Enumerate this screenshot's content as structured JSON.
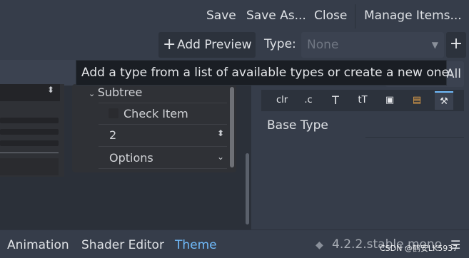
{
  "menu": {
    "save": "Save",
    "save_as": "Save As...",
    "close": "Close",
    "manage_items": "Manage Items..."
  },
  "toolbar": {
    "add_preview_icon": "+",
    "add_preview": "Add Preview",
    "type_label": "Type:",
    "type_value": "None",
    "add_type_icon": "+"
  },
  "tooltip": {
    "text": "Add a type from a list of available types or create a new one."
  },
  "preview": {
    "subtree_label": "Subtree",
    "check_item": "Check Item",
    "spin_value": "2",
    "options_value": "Options"
  },
  "inspector": {
    "all_label": "All",
    "tabs": [
      {
        "icon": "color-icon",
        "glyph": "clr"
      },
      {
        "icon": "constant-icon",
        "glyph": ".c"
      },
      {
        "icon": "font-icon",
        "glyph": "T"
      },
      {
        "icon": "font-size-icon",
        "glyph": "tT"
      },
      {
        "icon": "image-icon",
        "glyph": "▣"
      },
      {
        "icon": "stylebox-icon",
        "glyph": "▤"
      },
      {
        "icon": "tools-icon",
        "glyph": "⚒"
      }
    ],
    "base_type_label": "Base Type"
  },
  "bottom": {
    "tabs": [
      "Animation",
      "Shader Editor",
      "Theme"
    ],
    "active_tab": "Theme",
    "version": "4.2.2.stable.mono",
    "watermark": "CSDN @鹤安LK5937"
  },
  "colors": {
    "accent": "#70bafa",
    "background": "#363d4a",
    "panel": "#2c323c"
  }
}
